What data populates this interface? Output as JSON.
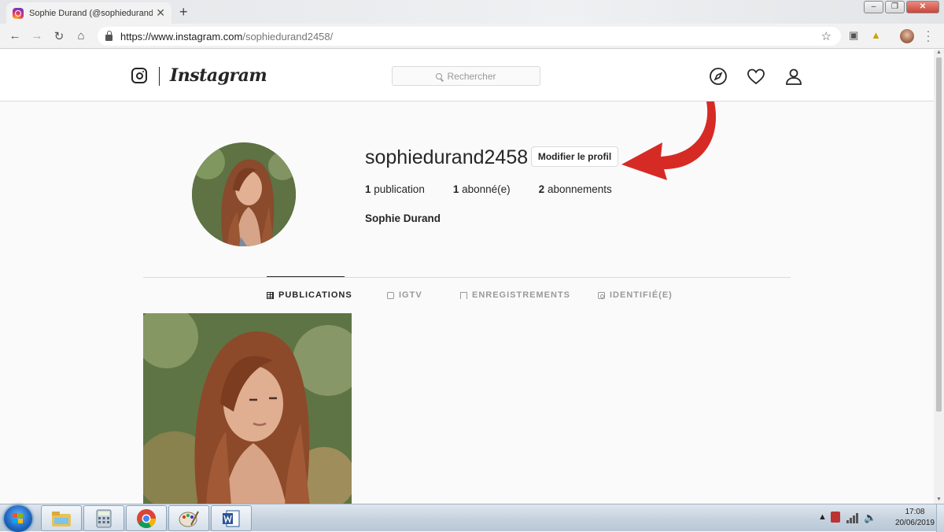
{
  "browser": {
    "tab_title": "Sophie Durand (@sophiedurand…",
    "tab_close": "✕",
    "new_tab": "+",
    "url_host": "https://www.instagram.com",
    "url_path": "/sophiedurand2458/",
    "window_controls": {
      "minimize": "–",
      "restore": "❐",
      "close": "✕"
    }
  },
  "instagram": {
    "wordmark": "Instagram",
    "search_placeholder": "Rechercher"
  },
  "profile": {
    "username": "sophiedurand2458",
    "edit_button": "Modifier le profil",
    "stats": [
      {
        "count": "1",
        "label": "publication"
      },
      {
        "count": "1",
        "label": "abonné(e)"
      },
      {
        "count": "2",
        "label": "abonnements"
      }
    ],
    "full_name": "Sophie Durand"
  },
  "tabs": [
    {
      "label": "PUBLICATIONS",
      "icon": "grid-icon",
      "active": true
    },
    {
      "label": "IGTV",
      "icon": "igtv-icon",
      "active": false
    },
    {
      "label": "ENREGISTREMENTS",
      "icon": "bookmark-icon",
      "active": false
    },
    {
      "label": "IDENTIFIÉ(E)",
      "icon": "tagged-icon",
      "active": false
    }
  ],
  "annotation": {
    "arrow_color": "#d62b24"
  },
  "taskbar": {
    "time": "17:08",
    "date": "20/06/2019",
    "apps": [
      "explorer-icon",
      "calculator-icon",
      "chrome-icon",
      "paint-icon",
      "word-icon"
    ]
  }
}
